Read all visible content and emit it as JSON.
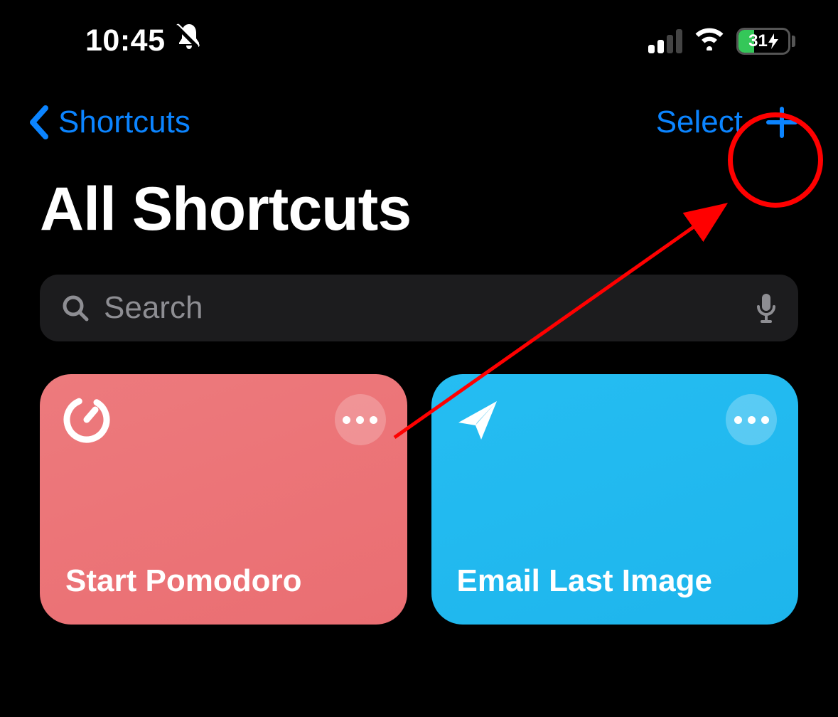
{
  "status": {
    "time": "10:45",
    "silent": true,
    "battery_pct": "31",
    "charging": true
  },
  "nav": {
    "back_label": "Shortcuts",
    "select_label": "Select"
  },
  "title": "All Shortcuts",
  "search": {
    "placeholder": "Search"
  },
  "cards": [
    {
      "label": "Start Pomodoro",
      "icon": "timer",
      "color": "red"
    },
    {
      "label": "Email Last Image",
      "icon": "send",
      "color": "blue"
    }
  ],
  "colors": {
    "accent_blue": "#0b84ff",
    "card_red": "#ea6e72",
    "card_blue": "#1eb5ec",
    "battery_green": "#34c759",
    "annotation_red": "#ff0000"
  },
  "annotation": {
    "target": "add-shortcut-button",
    "type": "circle-with-arrow"
  }
}
